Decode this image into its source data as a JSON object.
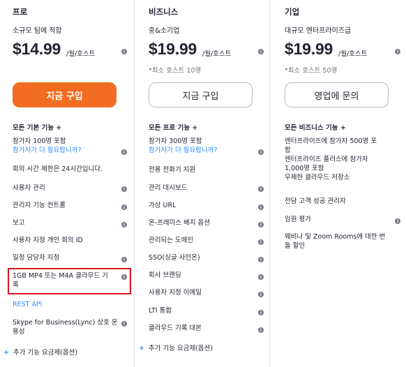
{
  "plans": {
    "pro": {
      "name": "프로",
      "desc": "소규모 팀에 적합",
      "price": "$14.99",
      "unit": "/월/호스트",
      "button": "지금 구입",
      "section_title": "모든 기본 기능 +",
      "features": {
        "participants_line1": "참가자 100명 포함",
        "participants_line2": "참가자가 더 필요합니까?",
        "meeting_limit": "회의 시간 제한은 24시간입니다.",
        "user_mgmt": "사용자 관리",
        "admin_controls": "관리자 기능 컨트롤",
        "reports": "보고",
        "personal_id": "사용자 지정 개인 회의 ID",
        "scheduler": "일정 담당자 지정",
        "cloud_line1": "1GB MP4 또는 M4A 클라우드 기",
        "cloud_line2": "록",
        "rest_api": "REST API",
        "skype_line1": "Skype for Business(Lync) 상호 운",
        "skype_line2": "용성",
        "addon": "추가 기능 요금제(옵션)"
      }
    },
    "business": {
      "name": "비즈니스",
      "desc": "중&소기업",
      "price": "$19.99",
      "unit": "/월/호스트",
      "note": "*최소 호스트 10명",
      "button": "지금 구입",
      "section_title": "모든 프로 기능 +",
      "features": {
        "participants_line1": "참가자 300명 포함",
        "participants_line2": "참가자가 더 필요합니까?",
        "dial_in": "전용 전화기 지원",
        "admin_dashboard": "관리 대시보드",
        "vanity_url": "가상 URL",
        "on_prem": "온-프레미스 배치 옵션",
        "managed_domains": "관리되는 도메인",
        "sso": "SSO(싱글 사인온)",
        "branding": "회사 브랜딩",
        "custom_email": "사용자 지정 이메일",
        "lti": "LTI 통합",
        "cloud_transcript": "클라우드 기록 대본",
        "addon": "추가 기능 요금제(옵션)"
      }
    },
    "enterprise": {
      "name": "기업",
      "desc": "대규모 엔터프라이즈급",
      "price": "$19.99",
      "unit": "/월/호스트",
      "note": "*최소 호스트 50명",
      "button": "영업에 문의",
      "section_title": "모든 비즈니스 기능 +",
      "features": {
        "line1": "엔터프라이즈에 참가자 500명 포",
        "line2": "함",
        "line3": "엔터프라이즈 플러스에 참가자",
        "line4": "1,000명 포함",
        "line5": "무제한 클라우드 저장소",
        "success_mgr": "전담 고객 성공 관리자",
        "exec_review": "임원 평가",
        "webinar_line1": "웨비나 및 Zoom Rooms에 대한 번",
        "webinar_line2": "들 할인"
      }
    }
  },
  "icons": {
    "info": "i",
    "plus": "+"
  },
  "colors": {
    "accent": "#f26d21",
    "link": "#2d8cff",
    "highlight": "#e0131f"
  }
}
